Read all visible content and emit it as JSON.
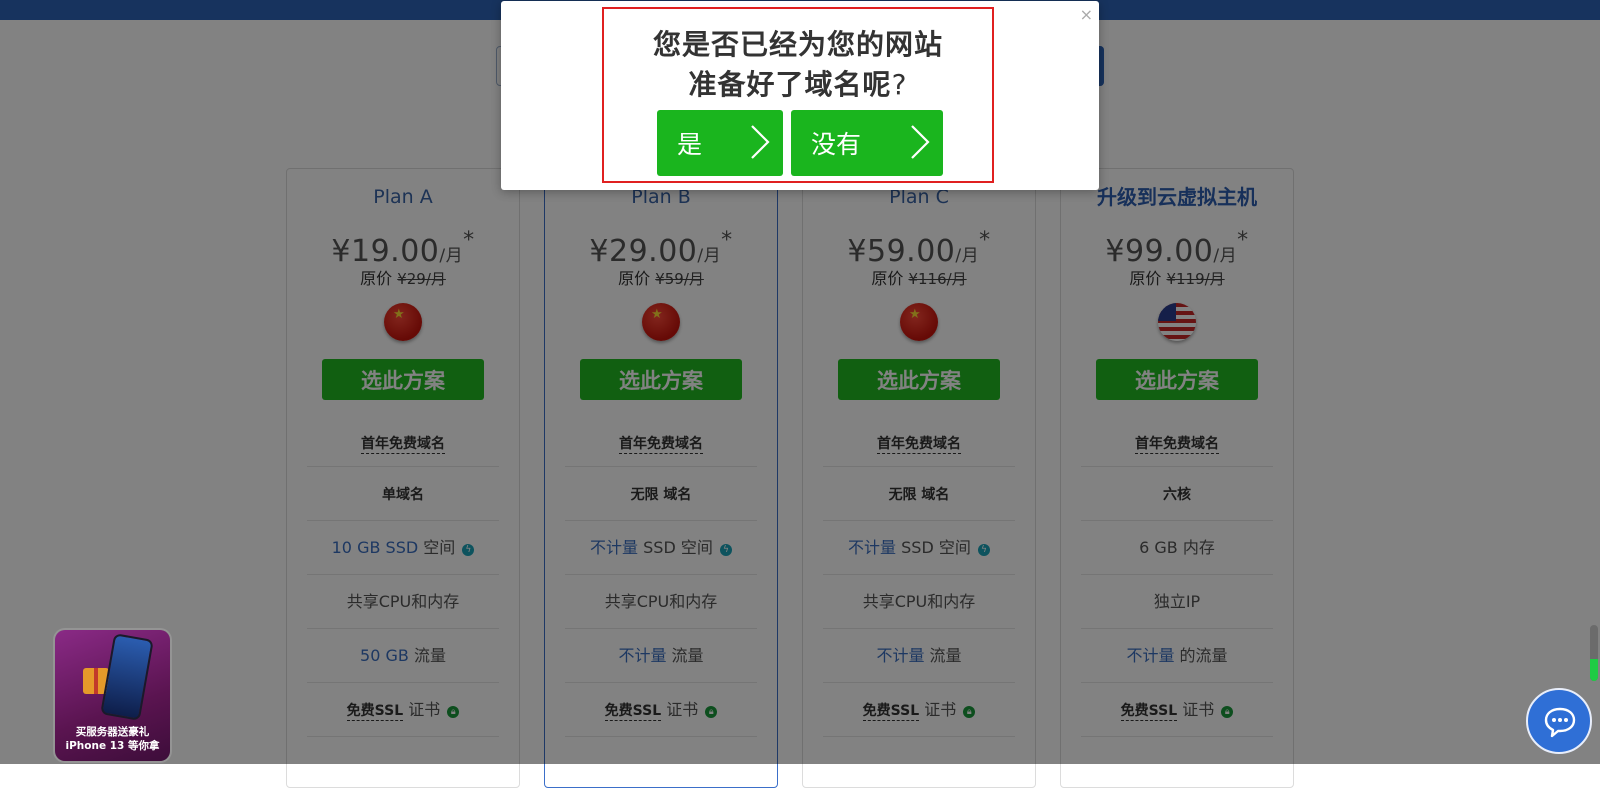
{
  "plans": [
    {
      "name": "Plan A",
      "price": "¥19.00",
      "per": "/月",
      "star": "*",
      "orig_label": "原价",
      "orig_price": "¥29/月",
      "flag": "cn-flag",
      "button": "选此方案",
      "f1": "首年免费域名",
      "f2": "单域名",
      "f3_a": "10 GB SSD",
      "f3_b": " 空间",
      "f4": "共享CPU和内存",
      "f5_a": "50 GB",
      "f5_b": " 流量",
      "f6_a": "免费SSL",
      "f6_b": " 证书"
    },
    {
      "name": "Plan B",
      "price": "¥29.00",
      "per": "/月",
      "star": "*",
      "orig_label": "原价",
      "orig_price": "¥59/月",
      "flag": "cn-flag",
      "button": "选此方案",
      "f1": "首年免费域名",
      "f2": "无限 域名",
      "f3_a": "不计量",
      "f3_b": " SSD 空间",
      "f4": "共享CPU和内存",
      "f5_a": "不计量",
      "f5_b": " 流量",
      "f6_a": "免费SSL",
      "f6_b": " 证书"
    },
    {
      "name": "Plan C",
      "price": "¥59.00",
      "per": "/月",
      "star": "*",
      "orig_label": "原价",
      "orig_price": "¥116/月",
      "flag": "cn-flag",
      "button": "选此方案",
      "f1": "首年免费域名",
      "f2": "无限 域名",
      "f3_a": "不计量",
      "f3_b": " SSD 空间",
      "f4": "共享CPU和内存",
      "f5_a": "不计量",
      "f5_b": " 流量",
      "f6_a": "免费SSL",
      "f6_b": " 证书"
    },
    {
      "name": "升级到云虚拟主机",
      "price": "¥99.00",
      "per": "/月",
      "star": "*",
      "orig_label": "原价",
      "orig_price": "¥119/月",
      "flag": "us-flag",
      "button": "选此方案",
      "f1": "首年免费域名",
      "f2": "六核",
      "f3_a": "6 GB",
      "f3_b": " 内存",
      "f4": "独立IP",
      "f5_a": "不计量",
      "f5_b": " 的流量",
      "f6_a": "免费SSL",
      "f6_b": " 证书"
    }
  ],
  "modal": {
    "close": "×",
    "question_line1": "您是否已经为您的网站",
    "question_line2": "准备好了域名呢",
    "question_mark": "?",
    "yes_label": "是",
    "no_label": "没有"
  },
  "promo": {
    "line1": "买服务器送豪礼",
    "line2": "iPhone 13 等你拿"
  },
  "scroll_progress": 0.4,
  "colors": {
    "brand_blue": "#2e64b9",
    "cta_green": "#1ab51e",
    "highlight_red": "#e02020",
    "accent_blue_text": "#3a6ec0"
  }
}
